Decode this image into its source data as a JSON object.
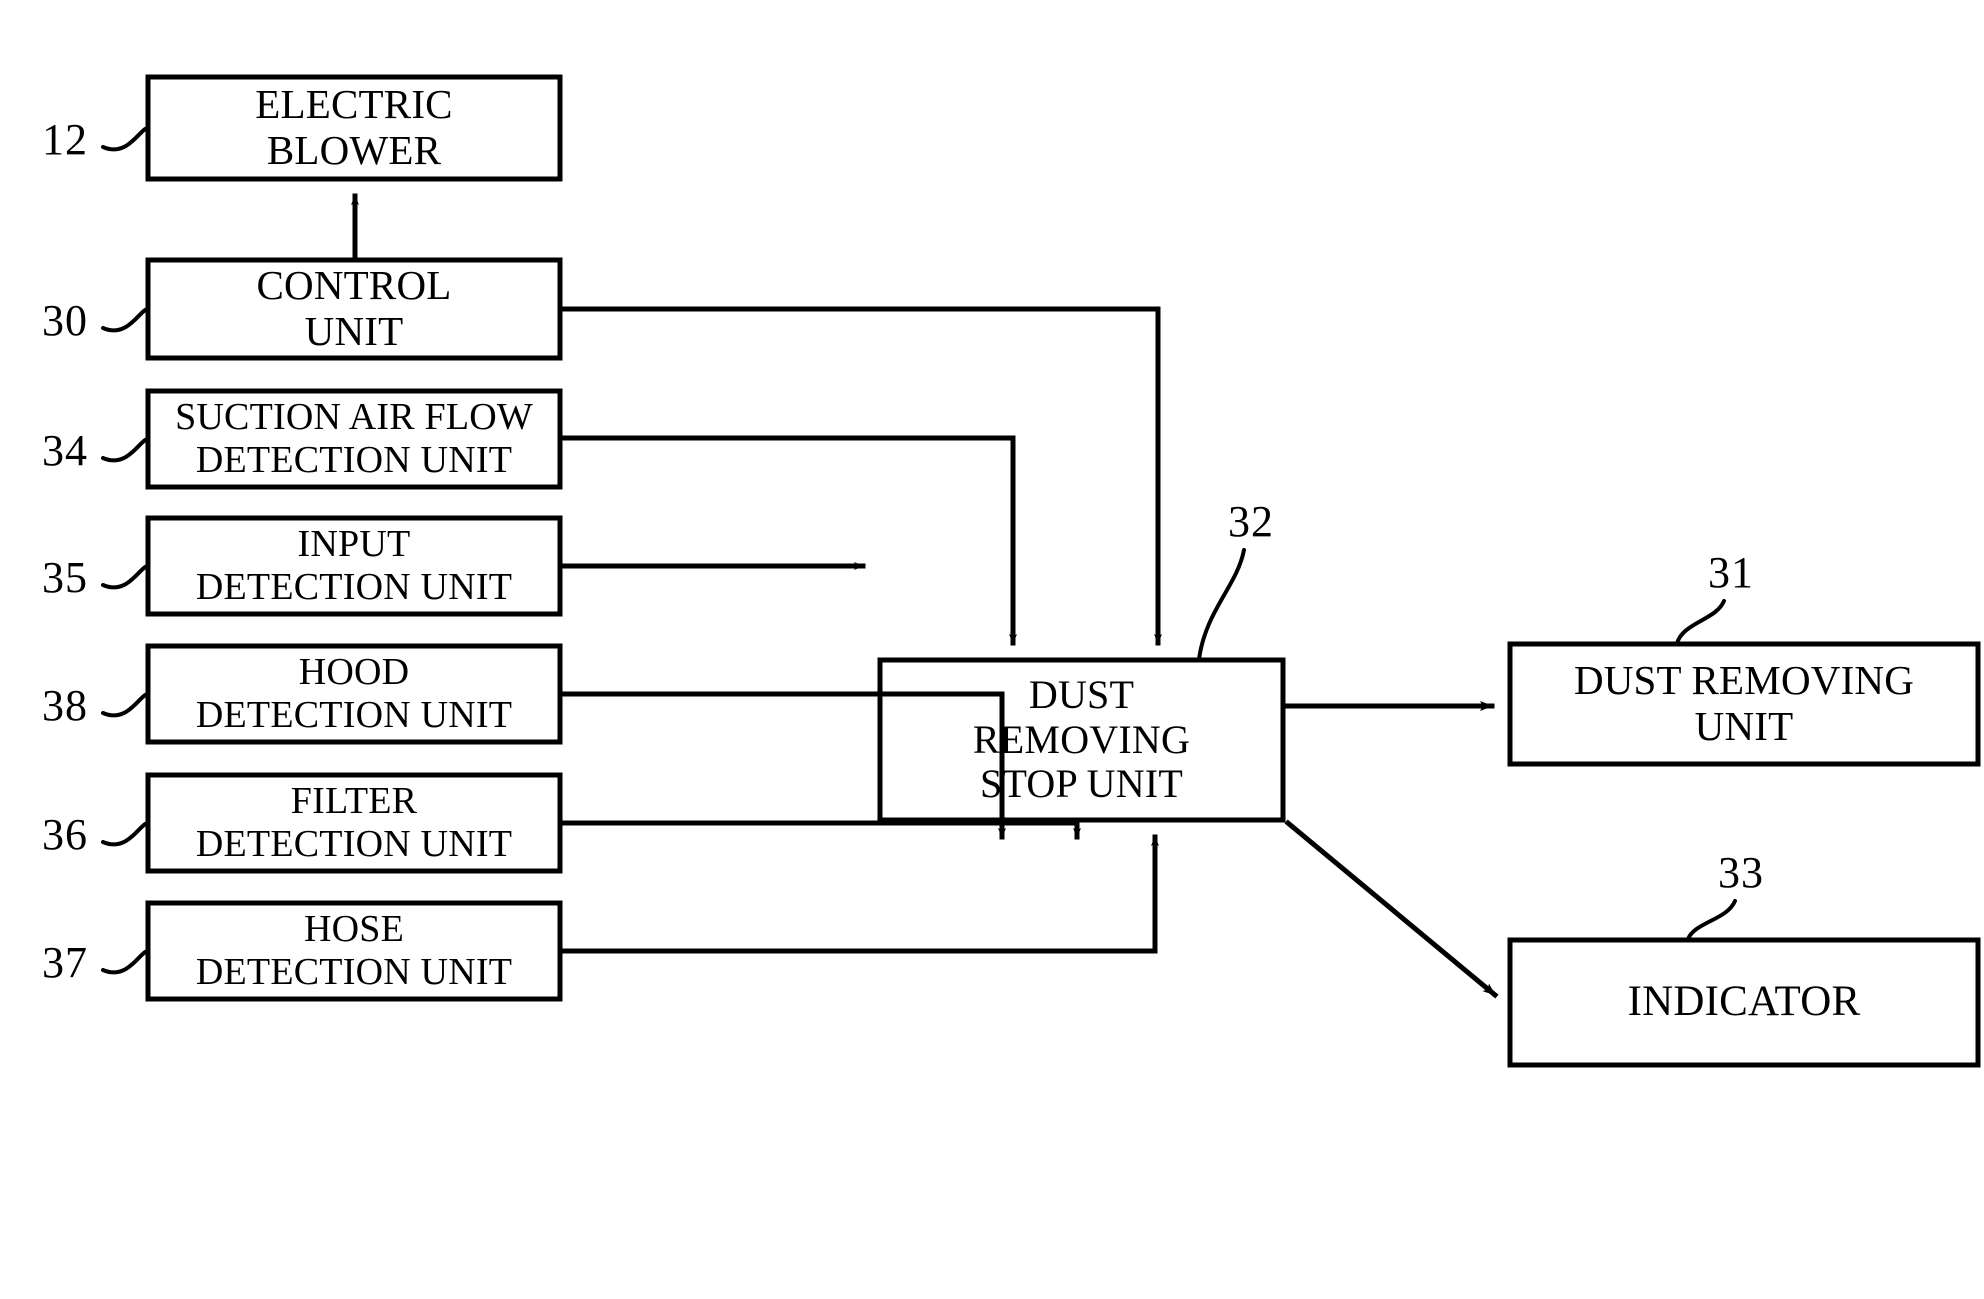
{
  "figure": {
    "type": "patent-block-diagram",
    "background_color": "#ffffff",
    "line_color": "#000000",
    "text_color": "#000000"
  },
  "blocks": {
    "electric_blower": {
      "ref": "12",
      "line1": "ELECTRIC",
      "line2": "BLOWER"
    },
    "control_unit": {
      "ref": "30",
      "line1": "CONTROL",
      "line2": "UNIT"
    },
    "suction_air_flow_detection_unit": {
      "ref": "34",
      "line1": "SUCTION AIR FLOW",
      "line2": "DETECTION UNIT"
    },
    "input_detection_unit": {
      "ref": "35",
      "line1": "INPUT",
      "line2": "DETECTION UNIT"
    },
    "hood_detection_unit": {
      "ref": "38",
      "line1": "HOOD",
      "line2": "DETECTION UNIT"
    },
    "filter_detection_unit": {
      "ref": "36",
      "line1": "FILTER",
      "line2": "DETECTION UNIT"
    },
    "hose_detection_unit": {
      "ref": "37",
      "line1": "HOSE",
      "line2": "DETECTION UNIT"
    },
    "dust_removing_stop_unit": {
      "ref": "32",
      "line1": "DUST",
      "line2": "REMOVING",
      "line3": "STOP UNIT"
    },
    "dust_removing_unit": {
      "ref": "31",
      "line1": "DUST REMOVING",
      "line2": "UNIT"
    },
    "indicator": {
      "ref": "33",
      "line1": "INDICATOR"
    }
  },
  "connections": [
    {
      "name": "control-unit-to-electric-blower",
      "from": "control_unit",
      "to": "electric_blower",
      "style": "vertical-arrow-up"
    },
    {
      "name": "control-unit-to-dust-removing-stop-unit",
      "from": "control_unit",
      "to": "dust_removing_stop_unit",
      "style": "right-down-arrow"
    },
    {
      "name": "suction-air-flow-to-dust-removing-stop-unit",
      "from": "suction_air_flow_detection_unit",
      "to": "dust_removing_stop_unit",
      "style": "right-down-arrow"
    },
    {
      "name": "input-detection-to-dust-removing-stop-unit",
      "from": "input_detection_unit",
      "to": "dust_removing_stop_unit",
      "style": "horizontal-arrow-right"
    },
    {
      "name": "hood-detection-to-dust-removing-stop-unit",
      "from": "hood_detection_unit",
      "to": "dust_removing_stop_unit",
      "style": "right-up-arrow"
    },
    {
      "name": "filter-detection-to-dust-removing-stop-unit",
      "from": "filter_detection_unit",
      "to": "dust_removing_stop_unit",
      "style": "right-up-arrow"
    },
    {
      "name": "hose-detection-to-dust-removing-stop-unit",
      "from": "hose_detection_unit",
      "to": "dust_removing_stop_unit",
      "style": "right-up-arrow"
    },
    {
      "name": "dust-removing-stop-unit-to-dust-removing-unit",
      "from": "dust_removing_stop_unit",
      "to": "dust_removing_unit",
      "style": "horizontal-arrow-right"
    },
    {
      "name": "dust-removing-stop-unit-to-indicator",
      "from": "dust_removing_stop_unit",
      "to": "indicator",
      "style": "diagonal-arrow"
    }
  ]
}
